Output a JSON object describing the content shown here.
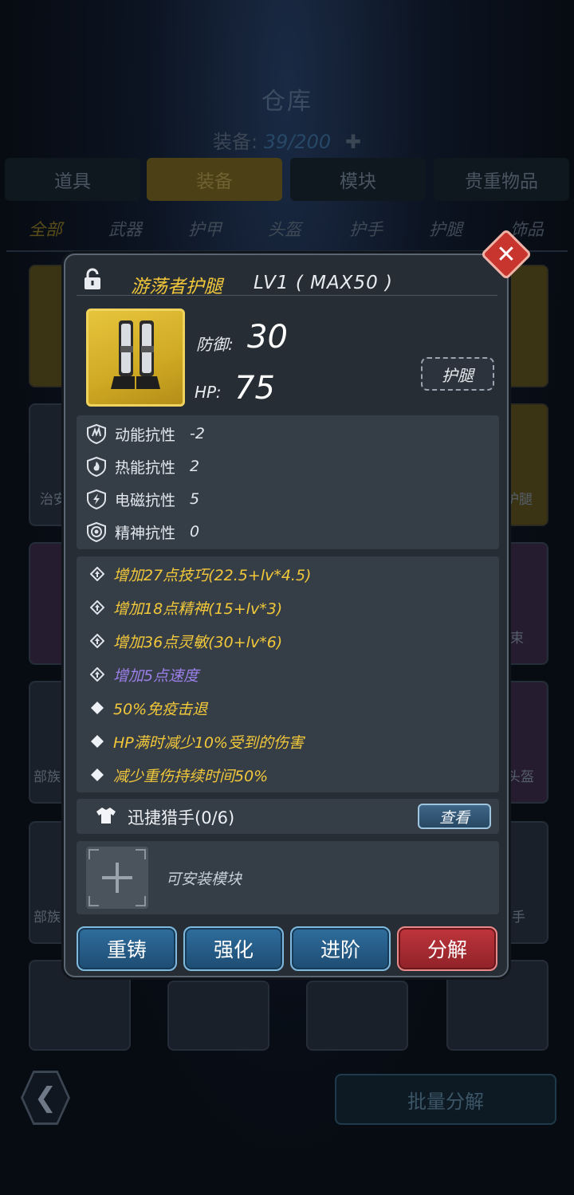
{
  "background": {
    "title": "仓库",
    "equipment_count_label": "装备:",
    "equipment_count_value": "39/200",
    "tabs": [
      {
        "label": "道具",
        "active": false
      },
      {
        "label": "装备",
        "active": true
      },
      {
        "label": "模块",
        "active": false
      },
      {
        "label": "贵重物品",
        "active": false
      }
    ],
    "subtabs": [
      {
        "label": "全部",
        "active": true
      },
      {
        "label": "武器",
        "active": false
      },
      {
        "label": "护甲",
        "active": false
      },
      {
        "label": "头盔",
        "active": false
      },
      {
        "label": "护手",
        "active": false
      },
      {
        "label": "护腿",
        "active": false
      },
      {
        "label": "饰品",
        "active": false
      }
    ],
    "card_labels": {
      "left_row2": "治安",
      "left_row4": "部族",
      "left_row5": "部族",
      "right_row2": "护腿",
      "right_row3": "束",
      "right_row4": "头盔",
      "right_row5": "手"
    },
    "batch_button": "批量分解"
  },
  "item": {
    "name": "游荡者护腿",
    "level": "LV1 ( MAX50 )",
    "defense_label": "防御:",
    "defense_value": "30",
    "hp_label": "HP:",
    "hp_value": "75",
    "type_tag": "护腿",
    "resistances": [
      {
        "icon": "kinetic-resist-icon",
        "name": "动能抗性",
        "value": "-2"
      },
      {
        "icon": "thermal-resist-icon",
        "name": "热能抗性",
        "value": "2"
      },
      {
        "icon": "electromagnetic-resist-icon",
        "name": "电磁抗性",
        "value": "5"
      },
      {
        "icon": "mental-resist-icon",
        "name": "精神抗性",
        "value": "0"
      }
    ],
    "attributes": [
      {
        "text": "增加27点技巧(22.5+lv*4.5)",
        "color": "#f2c83a",
        "icon": "upgrade-gem-icon"
      },
      {
        "text": "增加18点精神(15+lv*3)",
        "color": "#f2c83a",
        "icon": "upgrade-gem-icon"
      },
      {
        "text": "增加36点灵敏(30+lv*6)",
        "color": "#f2c83a",
        "icon": "upgrade-gem-icon"
      },
      {
        "text": "增加5点速度",
        "color": "#9c7fe8",
        "icon": "upgrade-gem-icon"
      },
      {
        "text": "50%免疫击退",
        "color": "#f2c83a",
        "icon": "diamond-icon"
      },
      {
        "text": "HP满时减少10%受到的伤害",
        "color": "#f2c83a",
        "icon": "diamond-icon"
      },
      {
        "text": "减少重伤持续时间50%",
        "color": "#f2c83a",
        "icon": "diamond-icon"
      }
    ],
    "set_name": "迅捷猎手(0/6)",
    "view_button": "查看",
    "module_slot_text": "可安装模块",
    "actions": [
      {
        "label": "重铸",
        "style": "blue"
      },
      {
        "label": "强化",
        "style": "blue"
      },
      {
        "label": "进阶",
        "style": "blue"
      },
      {
        "label": "分解",
        "style": "red"
      }
    ]
  }
}
